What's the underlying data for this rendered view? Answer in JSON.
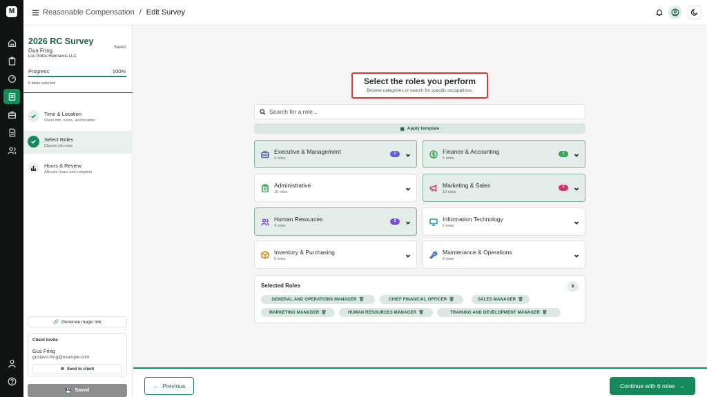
{
  "rail": {
    "logo": "M",
    "items": [
      "home-icon",
      "clipboard-icon",
      "gauge-icon",
      "survey-icon",
      "briefcase-icon",
      "document-icon",
      "users-icon"
    ],
    "bottom": [
      "user-icon",
      "help-icon"
    ]
  },
  "topbar": {
    "breadcrumb_root": "Reasonable Compensation",
    "breadcrumb_sep": "/",
    "breadcrumb_current": "Edit Survey"
  },
  "sidebar": {
    "title": "2026 RC Survey",
    "client_name": "Gus Fring",
    "company": "Los Pollos Hermanos LLC",
    "saved_tag": "Saved",
    "progress_label": "Progress",
    "progress_pct": "100%",
    "progress_value": 1.0,
    "tasks": "6 tasks selected",
    "steps": [
      {
        "title": "Time & Location",
        "sub": "Client info, hours, and location",
        "state": "done"
      },
      {
        "title": "Select Roles",
        "sub": "Choose job roles",
        "state": "active"
      },
      {
        "title": "Hours & Review",
        "sub": "Allocate hours and complete",
        "state": "pending"
      }
    ],
    "magic_link": "Generate magic link",
    "invite": {
      "title": "Client Invite",
      "name": "Gus Fring",
      "email": "gustavo.fring@example.com",
      "send": "Send to client"
    },
    "saved_button": "Saved"
  },
  "main": {
    "heading": "Select the roles you perform",
    "subheading": "Browse categories or search for specific occupations.",
    "search_placeholder": "Search for a role...",
    "apply_template": "Apply template",
    "categories": [
      {
        "title": "Executive & Management",
        "sub": "9 roles",
        "badge": "2",
        "badge_color": "#5b5fe0",
        "selected": true,
        "icon": "briefcase-icon",
        "icon_color": "#4a67b8"
      },
      {
        "title": "Finance & Accounting",
        "sub": "6 roles",
        "badge": "1",
        "badge_color": "#3aa55b",
        "selected": true,
        "icon": "dollar-icon",
        "icon_color": "#3aa55b"
      },
      {
        "title": "Administrative",
        "sub": "15 roles",
        "badge": "",
        "selected": false,
        "icon": "clipboard-icon",
        "icon_color": "#3aa55b"
      },
      {
        "title": "Marketing & Sales",
        "sub": "13 roles",
        "badge": "1",
        "badge_color": "#d6336c",
        "selected": true,
        "icon": "megaphone-icon",
        "icon_color": "#d6336c"
      },
      {
        "title": "Human Resources",
        "sub": "4 roles",
        "badge": "2",
        "badge_color": "#7c4ddb",
        "selected": true,
        "icon": "users-icon",
        "icon_color": "#7c4ddb"
      },
      {
        "title": "Information Technology",
        "sub": "6 roles",
        "badge": "",
        "selected": false,
        "icon": "monitor-icon",
        "icon_color": "#1c9ab8"
      },
      {
        "title": "Inventory & Purchasing",
        "sub": "5 roles",
        "badge": "",
        "selected": false,
        "icon": "box-icon",
        "icon_color": "#e08a1e"
      },
      {
        "title": "Maintenance & Operations",
        "sub": "9 roles",
        "badge": "",
        "selected": false,
        "icon": "wrench-icon",
        "icon_color": "#3a6fd6"
      }
    ],
    "selected_roles": {
      "title": "Selected Roles",
      "count": "6",
      "chips": [
        "GENERAL AND OPERATIONS MANAGER",
        "CHIEF FINANCIAL OFFICER",
        "SALES MANAGER",
        "MARKETING MANAGER",
        "HUMAN RESOURCES MANAGER",
        "TRAINING AND DEVELOPMENT MANAGER"
      ]
    }
  },
  "footer": {
    "previous": "Previous",
    "continue": "Continue with 6 roles"
  },
  "colors": {
    "accent": "#178a5b",
    "highlight_box": "#d83a3a"
  }
}
